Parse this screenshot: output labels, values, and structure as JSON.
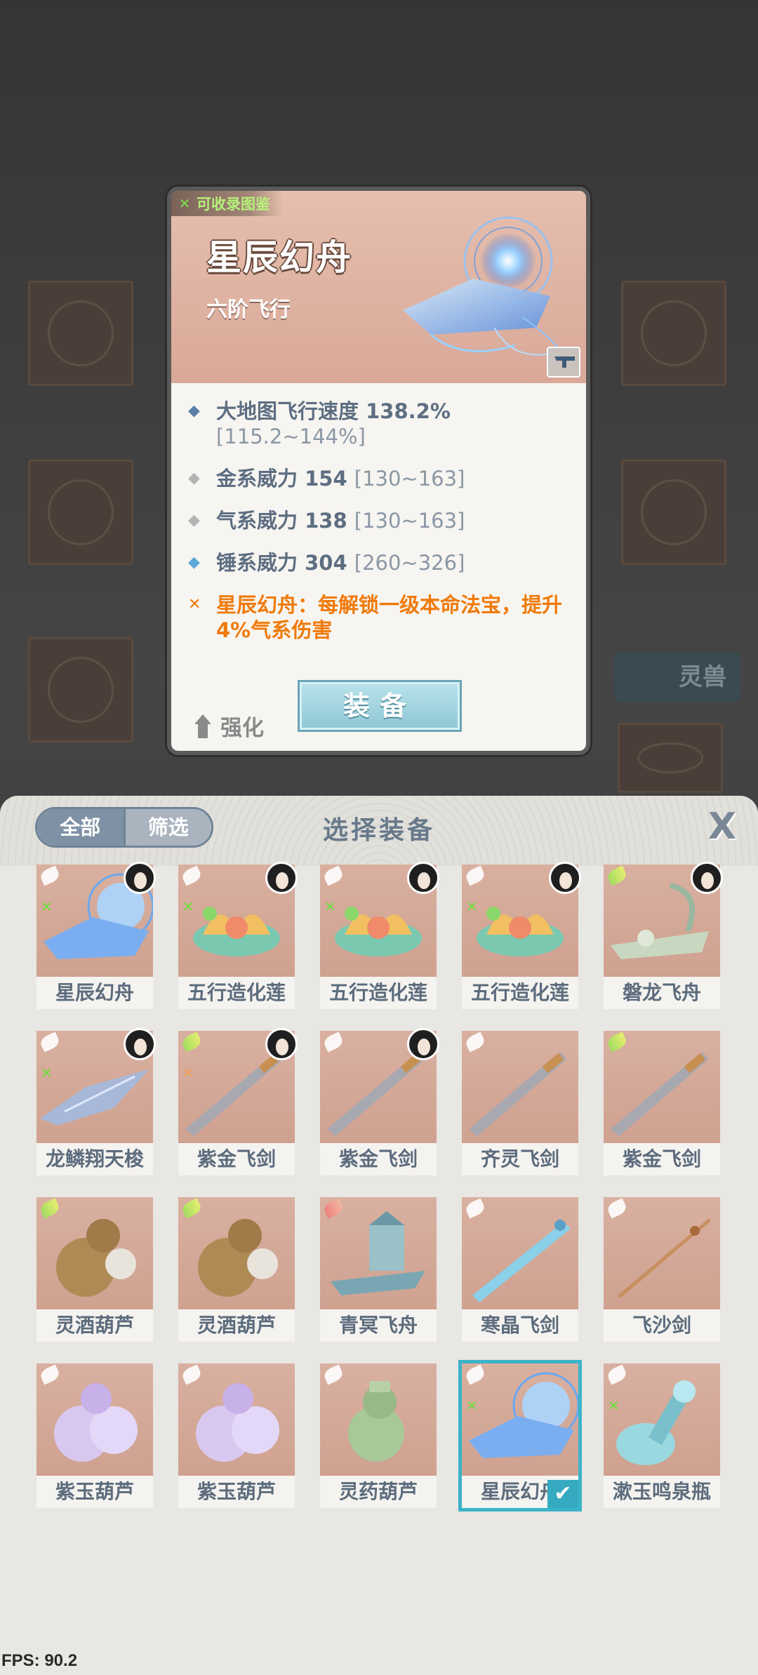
{
  "detail": {
    "collect_tag": "可收录图鉴",
    "title": "星辰幻舟",
    "subtitle": "六阶飞行",
    "stats": [
      {
        "label": "大地图飞行速度 138.2%",
        "range": "[115.2~144%]",
        "bullet": "blue"
      },
      {
        "label": "金系威力 154",
        "range": "[130~163]",
        "bullet": "grey"
      },
      {
        "label": "气系威力 138",
        "range": "[130~163]",
        "bullet": "grey"
      },
      {
        "label": "锤系威力 304",
        "range": "[260~326]",
        "bullet": "cyan"
      }
    ],
    "special_effect": "星辰幻舟：每解锁一级本命法宝，提升4%气系伤害",
    "upgrade_label": "强化",
    "equip_label": "装备"
  },
  "background": {
    "beast_label": "灵兽"
  },
  "panel": {
    "toggle_all": "全部",
    "toggle_filter": "筛选",
    "title": "选择装备",
    "close": "X"
  },
  "items": [
    {
      "name": "星辰幻舟",
      "art": "boat-blue",
      "wing": "white",
      "mark": "green",
      "avatar": true
    },
    {
      "name": "五行造化莲",
      "art": "lotus",
      "wing": "white",
      "mark": "green",
      "avatar": true
    },
    {
      "name": "五行造化莲",
      "art": "lotus",
      "wing": "white",
      "mark": "green",
      "avatar": true
    },
    {
      "name": "五行造化莲",
      "art": "lotus",
      "wing": "white",
      "mark": "green",
      "avatar": true
    },
    {
      "name": "磐龙飞舟",
      "art": "boat-green",
      "wing": "green",
      "mark": "",
      "avatar": true
    },
    {
      "name": "龙鳞翔天梭",
      "art": "shuttle",
      "wing": "white",
      "mark": "green",
      "avatar": true
    },
    {
      "name": "紫金飞剑",
      "art": "sword",
      "wing": "green",
      "mark": "orange",
      "avatar": true
    },
    {
      "name": "紫金飞剑",
      "art": "sword",
      "wing": "white",
      "mark": "",
      "avatar": true
    },
    {
      "name": "齐灵飞剑",
      "art": "sword",
      "wing": "white",
      "mark": "",
      "avatar": false
    },
    {
      "name": "紫金飞剑",
      "art": "sword",
      "wing": "green",
      "mark": "",
      "avatar": false
    },
    {
      "name": "灵酒葫芦",
      "art": "gourd-brown",
      "wing": "green",
      "mark": "",
      "avatar": false
    },
    {
      "name": "灵酒葫芦",
      "art": "gourd-brown",
      "wing": "green",
      "mark": "",
      "avatar": false
    },
    {
      "name": "青冥飞舟",
      "art": "boat-teal",
      "wing": "pink",
      "mark": "",
      "avatar": false
    },
    {
      "name": "寒晶飞剑",
      "art": "sword-ice",
      "wing": "white",
      "mark": "",
      "avatar": false
    },
    {
      "name": "飞沙剑",
      "art": "sword-thin",
      "wing": "white",
      "mark": "",
      "avatar": false
    },
    {
      "name": "紫玉葫芦",
      "art": "gourd-purple",
      "wing": "white",
      "mark": "",
      "avatar": false
    },
    {
      "name": "紫玉葫芦",
      "art": "gourd-purple",
      "wing": "white",
      "mark": "",
      "avatar": false
    },
    {
      "name": "灵药葫芦",
      "art": "gourd-green",
      "wing": "white",
      "mark": "",
      "avatar": false
    },
    {
      "name": "星辰幻舟",
      "art": "boat-blue",
      "wing": "white",
      "mark": "green",
      "avatar": false,
      "selected": true
    },
    {
      "name": "漱玉鸣泉瓶",
      "art": "bottle",
      "wing": "white",
      "mark": "green",
      "avatar": false
    }
  ],
  "fps": "FPS: 90.2"
}
